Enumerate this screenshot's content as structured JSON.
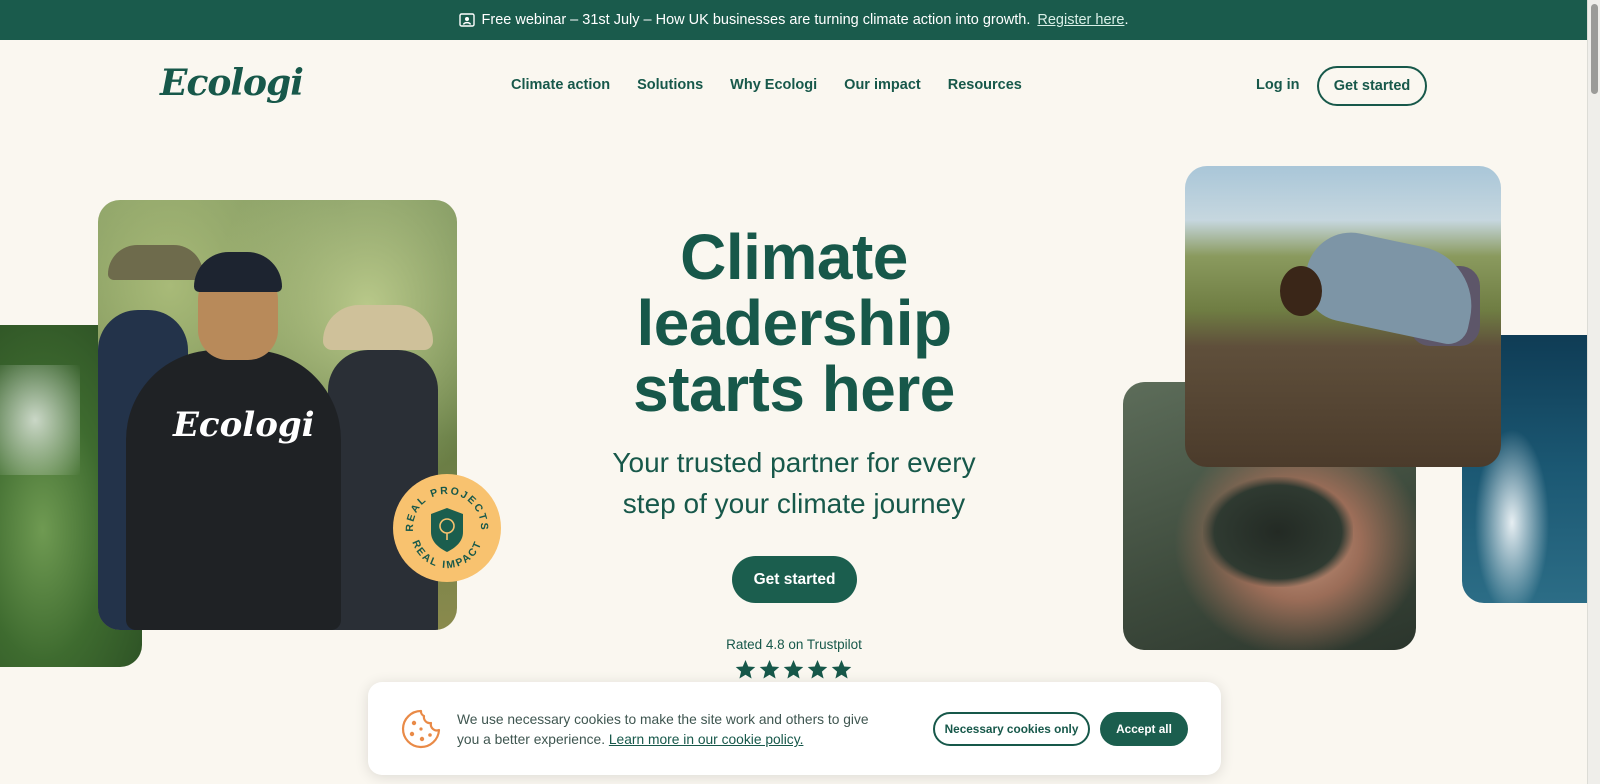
{
  "banner": {
    "text": "Free webinar – 31st July – How UK businesses are turning climate action into growth.",
    "link_label": "Register here",
    "suffix": ".",
    "icon": "presentation-icon"
  },
  "nav": {
    "logo": "Ecologi",
    "links": [
      "Climate action",
      "Solutions",
      "Why Ecologi",
      "Our impact",
      "Resources"
    ],
    "login_label": "Log in",
    "cta_label": "Get started"
  },
  "hero": {
    "title": "Climate leadership starts here",
    "subtitle": "Your trusted partner for every step of your climate journey",
    "cta_label": "Get started",
    "rating_text": "Rated 4.8 on Trustpilot",
    "stars": 5
  },
  "photos": {
    "shirt_logo": "Ecologi",
    "badge_top": "REAL PROJECTS",
    "badge_bottom": "REAL IMPACT"
  },
  "cookie": {
    "text": "We use necessary cookies to make the site work and others to give you a better experience.",
    "link_label": "Learn more in our cookie policy.",
    "necessary_label": "Necessary cookies only",
    "accept_label": "Accept all"
  },
  "colors": {
    "brand": "#17584a",
    "banner_bg": "#1a5b4c",
    "page_bg": "#faf7f0",
    "badge": "#f8c26f",
    "cookie_icon": "#e98a47"
  }
}
